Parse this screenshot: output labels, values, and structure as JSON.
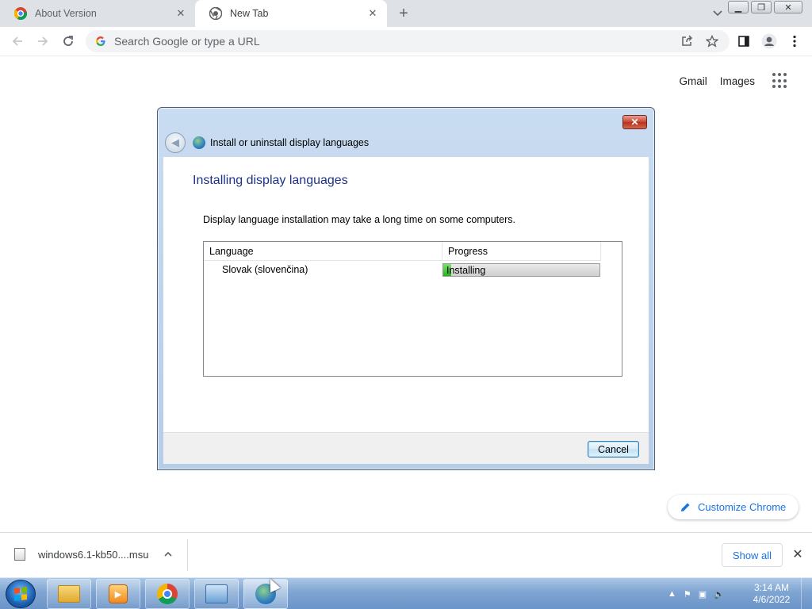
{
  "browser": {
    "tabs": [
      {
        "title": "About Version",
        "active": false
      },
      {
        "title": "New Tab",
        "active": true
      }
    ],
    "new_tab_symbol": "+",
    "omnibox_placeholder": "Search Google or type a URL",
    "toolbar_icons": [
      "back-icon",
      "forward-icon",
      "reload-icon",
      "share-icon",
      "star-icon",
      "side-panel-icon",
      "profile-icon",
      "menu-icon"
    ]
  },
  "ntp": {
    "gmail_label": "Gmail",
    "images_label": "Images",
    "customize_label": "Customize Chrome"
  },
  "download_bar": {
    "filename": "windows6.1-kb50....msu",
    "show_all_label": "Show all"
  },
  "dialog": {
    "title": "Install or uninstall display languages",
    "heading": "Installing display languages",
    "description": "Display language installation may take a long time on some computers.",
    "columns": [
      "Language",
      "Progress"
    ],
    "rows": [
      {
        "language": "Slovak (slovenčina)",
        "status": "Installing",
        "progress": 0.05
      }
    ],
    "cancel_label": "Cancel"
  },
  "taskbar": {
    "time": "3:14 AM",
    "date": "4/6/2022",
    "apps": [
      "explorer",
      "media-player",
      "chrome",
      "control-panel",
      "language-installer"
    ]
  },
  "colors": {
    "progress_fill": "#25b31b",
    "dialog_heading": "#1e3287",
    "link_blue": "#1a73e8"
  }
}
